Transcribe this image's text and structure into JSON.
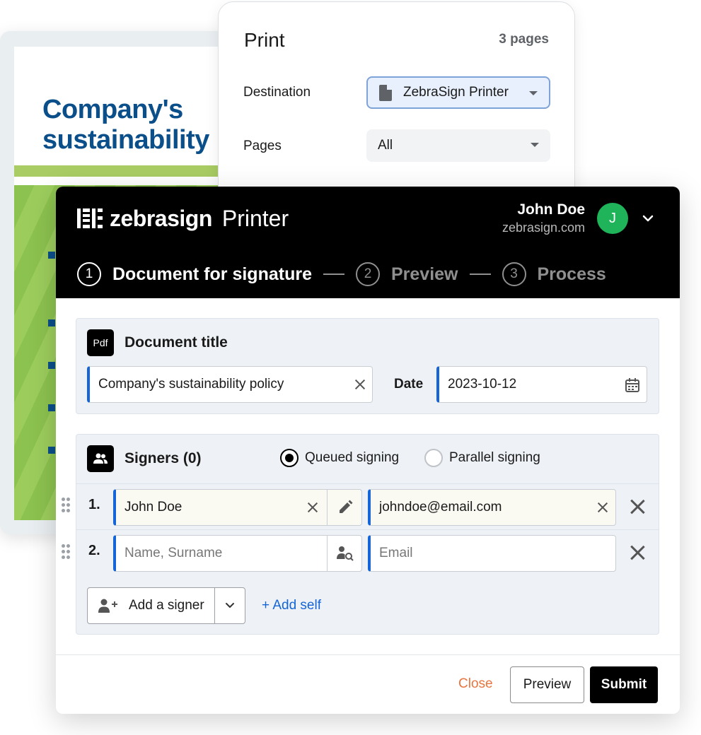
{
  "background_document": {
    "title_line1": "Company's",
    "title_line2": "sustainability"
  },
  "print_panel": {
    "title": "Print",
    "page_count": "3 pages",
    "destination_label": "Destination",
    "destination_value": "ZebraSign Printer",
    "pages_label": "Pages",
    "pages_value": "All"
  },
  "header": {
    "brand_name": "zebrasign",
    "product_name": "Printer",
    "user_name": "John Doe",
    "user_domain": "zebrasign.com",
    "avatar_initial": "J",
    "avatar_color": "#1fb45a"
  },
  "steps": [
    {
      "number": "1",
      "label": "Document for signature",
      "active": true
    },
    {
      "number": "2",
      "label": "Preview",
      "active": false
    },
    {
      "number": "3",
      "label": "Process",
      "active": false
    }
  ],
  "document_section": {
    "icon_text": "Pdf",
    "title": "Document title",
    "title_value": "Company's sustainability policy",
    "date_label": "Date",
    "date_value": "2023-10-12"
  },
  "signers_section": {
    "title": "Signers (0)",
    "signing_modes": [
      {
        "label": "Queued signing",
        "selected": true
      },
      {
        "label": "Parallel signing",
        "selected": false
      }
    ],
    "rows": [
      {
        "number": "1.",
        "name_value": "John Doe",
        "name_placeholder": "",
        "email_value": "johndoe@email.com",
        "email_placeholder": ""
      },
      {
        "number": "2.",
        "name_value": "",
        "name_placeholder": "Name, Surname",
        "email_value": "",
        "email_placeholder": "Email"
      }
    ],
    "add_signer_label": "Add a signer",
    "add_self_label": "+ Add self"
  },
  "footer": {
    "close_label": "Close",
    "preview_label": "Preview",
    "submit_label": "Submit"
  },
  "colors": {
    "accent_blue": "#1565d8",
    "close_orange": "#e8753f",
    "doc_title_blue": "#0b4f8a",
    "grass_green": "#8cc24f"
  }
}
